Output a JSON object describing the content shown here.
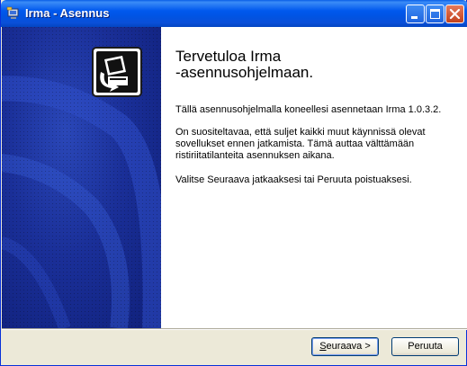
{
  "window": {
    "title": "Irma - Asennus"
  },
  "content": {
    "title": "Tervetuloa Irma\n-asennusohjelmaan.",
    "paragraph1": "Tällä asennusohjelmalla koneellesi asennetaan Irma 1.0.3.2.",
    "paragraph2": "On suositeltavaa, että suljet kaikki muut käynnissä olevat sovellukset ennen jatkamista. Tämä auttaa välttämään ristiriitatilanteita asennuksen aikana.",
    "paragraph3": "Valitse Seuraava jatkaaksesi tai Peruuta poistuaksesi."
  },
  "buttons": {
    "next_underlined": "S",
    "next_rest": "euraava >",
    "cancel": "Peruuta"
  },
  "icons": {
    "app": "installer-icon",
    "side": "computer-install-icon"
  },
  "colors": {
    "titlebar": "#0054e3",
    "side_panel": "#1a2f98",
    "dialog_bg": "#ece9d8"
  }
}
